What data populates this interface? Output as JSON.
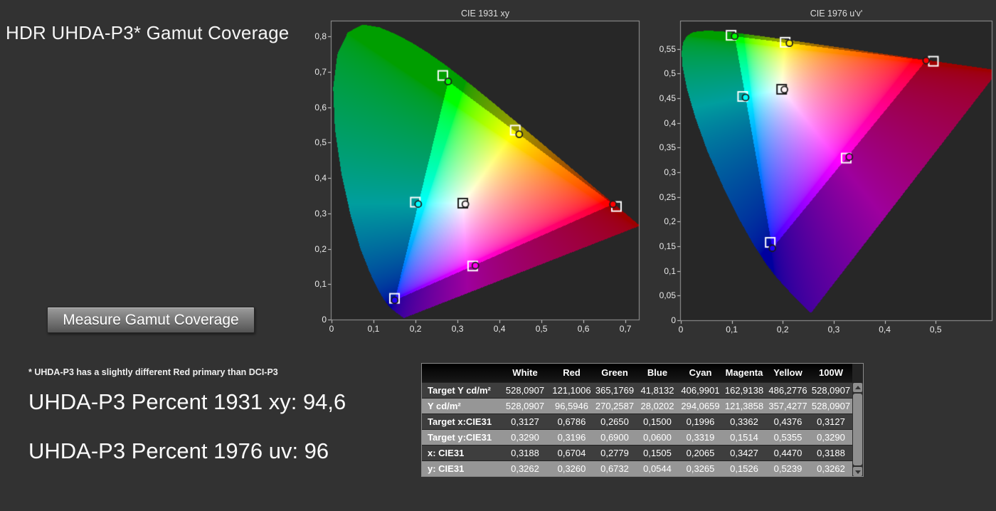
{
  "colors": {
    "background": "#323232",
    "plot_background": "#272727",
    "chart_border": "#9a9a9a",
    "tick_color": "#d4d4d4",
    "row_dark": "#3e3e3e",
    "row_light": "#969696",
    "button_top": "#9c9c9c",
    "button_bottom": "#545454",
    "scrollbar": "#8f8f8f",
    "marker_target": "#ffffff",
    "marker_target_white_patch": "#1a1a1a",
    "marker_circle_stroke": "#1b1b1b",
    "outside_gamut_dim": 0.35
  },
  "header": {
    "title": "HDR UHDA-P3* Gamut Coverage"
  },
  "controls": {
    "measure_button": "Measure Gamut Coverage"
  },
  "notes": {
    "footnote": "* UHDA-P3 has a slightly different Red primary than DCI-P3",
    "percent_1931": "UHDA-P3 Percent 1931 xy: 94,6",
    "percent_1976": "UHDA-P3 Percent 1976 uv: 96"
  },
  "table": {
    "columns": [
      "White",
      "Red",
      "Green",
      "Blue",
      "Cyan",
      "Magenta",
      "Yellow",
      "100W"
    ],
    "rows": [
      {
        "label": "Target Y cd/m²",
        "values": [
          "528,0907",
          "121,1006",
          "365,1769",
          "41,8132",
          "406,9901",
          "162,9138",
          "486,2776",
          "528,0907"
        ]
      },
      {
        "label": "Y cd/m²",
        "values": [
          "528,0907",
          "96,5946",
          "270,2587",
          "28,0202",
          "294,0659",
          "121,3858",
          "357,4277",
          "528,0907"
        ]
      },
      {
        "label": "Target x:CIE31",
        "values": [
          "0,3127",
          "0,6786",
          "0,2650",
          "0,1500",
          "0,1996",
          "0,3362",
          "0,4376",
          "0,3127"
        ]
      },
      {
        "label": "Target y:CIE31",
        "values": [
          "0,3290",
          "0,3196",
          "0,6900",
          "0,0600",
          "0,3319",
          "0,1514",
          "0,5355",
          "0,3290"
        ]
      },
      {
        "label": "x: CIE31",
        "values": [
          "0,3188",
          "0,6704",
          "0,2779",
          "0,1505",
          "0,2065",
          "0,3427",
          "0,4470",
          "0,3188"
        ]
      },
      {
        "label": "y: CIE31",
        "values": [
          "0,3262",
          "0,3260",
          "0,6732",
          "0,0544",
          "0,3265",
          "0,1526",
          "0,5239",
          "0,3262"
        ]
      }
    ]
  },
  "chart_data": [
    {
      "type": "scatter",
      "title": "CIE 1931 xy",
      "space": "xy",
      "xlim": [
        0,
        0.732
      ],
      "ylim": [
        0,
        0.843
      ],
      "grid": false,
      "x_ticks": {
        "values": [
          0,
          0.1,
          0.2,
          0.3,
          0.4,
          0.5,
          0.6,
          0.7
        ],
        "labels": [
          "0",
          "0,1",
          "0,2",
          "0,3",
          "0,4",
          "0,5",
          "0,6",
          "0,7"
        ]
      },
      "y_ticks": {
        "values": [
          0,
          0.1,
          0.2,
          0.3,
          0.4,
          0.5,
          0.6,
          0.7,
          0.8
        ],
        "labels": [
          "0",
          "0,1",
          "0,2",
          "0,3",
          "0,4",
          "0,5",
          "0,6",
          "0,7",
          "0,8"
        ]
      },
      "patches": [
        "White",
        "Red",
        "Green",
        "Blue",
        "Cyan",
        "Magenta",
        "Yellow"
      ],
      "target_xy": {
        "White": [
          0.3127,
          0.329
        ],
        "Red": [
          0.6786,
          0.3196
        ],
        "Green": [
          0.265,
          0.69
        ],
        "Blue": [
          0.15,
          0.06
        ],
        "Cyan": [
          0.1996,
          0.3319
        ],
        "Magenta": [
          0.3362,
          0.1514
        ],
        "Yellow": [
          0.4376,
          0.5355
        ]
      },
      "measured_xy": {
        "White": [
          0.3188,
          0.3262
        ],
        "Red": [
          0.6704,
          0.326
        ],
        "Green": [
          0.2779,
          0.6732
        ],
        "Blue": [
          0.1505,
          0.0544
        ],
        "Cyan": [
          0.2065,
          0.3265
        ],
        "Magenta": [
          0.3427,
          0.1526
        ],
        "Yellow": [
          0.447,
          0.5239
        ]
      },
      "gamut_triangle_measured": [
        "Red",
        "Green",
        "Blue"
      ],
      "spectral_locus_xy": [
        [
          0.1741,
          0.005
        ],
        [
          0.174,
          0.005
        ],
        [
          0.1738,
          0.0049
        ],
        [
          0.1736,
          0.0049
        ],
        [
          0.1733,
          0.0048
        ],
        [
          0.173,
          0.0048
        ],
        [
          0.1726,
          0.0048
        ],
        [
          0.1721,
          0.0048
        ],
        [
          0.1714,
          0.0051
        ],
        [
          0.1703,
          0.0058
        ],
        [
          0.1689,
          0.0069
        ],
        [
          0.1669,
          0.0086
        ],
        [
          0.1644,
          0.0109
        ],
        [
          0.1611,
          0.0138
        ],
        [
          0.1566,
          0.0177
        ],
        [
          0.151,
          0.0227
        ],
        [
          0.144,
          0.0297
        ],
        [
          0.1355,
          0.0399
        ],
        [
          0.1241,
          0.0578
        ],
        [
          0.1096,
          0.0868
        ],
        [
          0.0913,
          0.1327
        ],
        [
          0.0687,
          0.2007
        ],
        [
          0.0454,
          0.295
        ],
        [
          0.0235,
          0.4127
        ],
        [
          0.0082,
          0.5384
        ],
        [
          0.0039,
          0.6548
        ],
        [
          0.0139,
          0.7502
        ],
        [
          0.0389,
          0.812
        ],
        [
          0.0743,
          0.8338
        ],
        [
          0.1142,
          0.8262
        ],
        [
          0.1547,
          0.8059
        ],
        [
          0.1929,
          0.7816
        ],
        [
          0.2296,
          0.7543
        ],
        [
          0.2658,
          0.7243
        ],
        [
          0.3016,
          0.6923
        ],
        [
          0.3373,
          0.6589
        ],
        [
          0.3731,
          0.6245
        ],
        [
          0.4087,
          0.5896
        ],
        [
          0.4441,
          0.5547
        ],
        [
          0.4788,
          0.5202
        ],
        [
          0.5125,
          0.4866
        ],
        [
          0.5448,
          0.4544
        ],
        [
          0.5752,
          0.4242
        ],
        [
          0.6029,
          0.3965
        ],
        [
          0.627,
          0.3725
        ],
        [
          0.6482,
          0.3514
        ],
        [
          0.6658,
          0.334
        ],
        [
          0.6801,
          0.3197
        ],
        [
          0.6915,
          0.3083
        ],
        [
          0.7006,
          0.2993
        ],
        [
          0.7079,
          0.292
        ],
        [
          0.714,
          0.2859
        ],
        [
          0.719,
          0.2809
        ],
        [
          0.723,
          0.277
        ],
        [
          0.726,
          0.274
        ],
        [
          0.7283,
          0.2717
        ],
        [
          0.73,
          0.27
        ],
        [
          0.7311,
          0.2689
        ],
        [
          0.732,
          0.268
        ],
        [
          0.7327,
          0.2673
        ],
        [
          0.7334,
          0.2666
        ],
        [
          0.734,
          0.266
        ],
        [
          0.7344,
          0.2656
        ],
        [
          0.7346,
          0.2654
        ],
        [
          0.7347,
          0.2653
        ]
      ]
    },
    {
      "type": "scatter",
      "title": "CIE 1976 u'v'",
      "space": "uv",
      "xlim": [
        0,
        0.61
      ],
      "ylim": [
        0,
        0.606
      ],
      "grid": false,
      "x_ticks": {
        "values": [
          0,
          0.1,
          0.2,
          0.3,
          0.4,
          0.5
        ],
        "labels": [
          "0",
          "0,1",
          "0,2",
          "0,3",
          "0,4",
          "0,5"
        ]
      },
      "y_ticks": {
        "values": [
          0,
          0.05,
          0.1,
          0.15,
          0.2,
          0.25,
          0.3,
          0.35,
          0.4,
          0.45,
          0.5,
          0.55
        ],
        "labels": [
          "0",
          "0,05",
          "0,1",
          "0,15",
          "0,2",
          "0,25",
          "0,3",
          "0,35",
          "0,4",
          "0,45",
          "0,5",
          "0,55"
        ]
      },
      "patches": [
        "White",
        "Red",
        "Green",
        "Blue",
        "Cyan",
        "Magenta",
        "Yellow"
      ],
      "target_uv": {
        "White": [
          0.1978,
          0.4683
        ],
        "Red": [
          0.4955,
          0.5251
        ],
        "Green": [
          0.0986,
          0.5777
        ],
        "Blue": [
          0.1754,
          0.1579
        ],
        "Cyan": [
          0.1213,
          0.4537
        ],
        "Magenta": [
          0.3245,
          0.3288
        ],
        "Yellow": [
          0.2047,
          0.5636
        ]
      },
      "measured_uv": {
        "White": [
          0.2032,
          0.4677
        ],
        "Red": [
          0.4813,
          0.5266
        ],
        "Green": [
          0.1056,
          0.5758
        ],
        "Blue": [
          0.1796,
          0.1461
        ],
        "Cyan": [
          0.127,
          0.4517
        ],
        "Magenta": [
          0.3306,
          0.3313
        ],
        "Yellow": [
          0.2131,
          0.5618
        ]
      },
      "gamut_triangle_measured": [
        "Red",
        "Green",
        "Blue"
      ]
    }
  ]
}
